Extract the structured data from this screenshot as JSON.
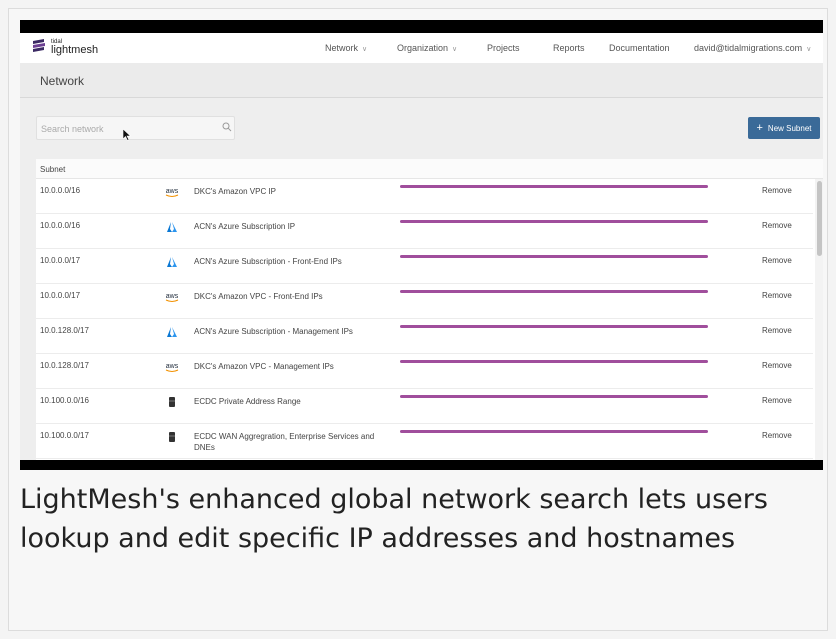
{
  "app": {
    "logo_small": "tidal",
    "logo_big": "lightmesh"
  },
  "nav": {
    "items": [
      {
        "label": "Network",
        "dropdown": true
      },
      {
        "label": "Organization",
        "dropdown": true
      },
      {
        "label": "Projects",
        "dropdown": false
      },
      {
        "label": "Reports",
        "dropdown": false
      },
      {
        "label": "Documentation",
        "dropdown": false
      },
      {
        "label": "david@tidalmigrations.com",
        "dropdown": true
      }
    ]
  },
  "page": {
    "title": "Network"
  },
  "search": {
    "placeholder": "Search network",
    "value": ""
  },
  "actions": {
    "new_subnet_label": "New Subnet"
  },
  "table": {
    "header_subnet": "Subnet",
    "remove_label": "Remove",
    "rows": [
      {
        "subnet": "10.0.0.0/16",
        "provider": "aws",
        "name": "DKC's Amazon VPC IP"
      },
      {
        "subnet": "10.0.0.0/16",
        "provider": "azure",
        "name": "ACN's Azure Subscription IP"
      },
      {
        "subnet": "10.0.0.0/17",
        "provider": "azure",
        "name": "ACN's Azure Subscription - Front-End IPs"
      },
      {
        "subnet": "10.0.0.0/17",
        "provider": "aws",
        "name": "DKC's Amazon VPC - Front-End IPs"
      },
      {
        "subnet": "10.0.128.0/17",
        "provider": "azure",
        "name": "ACN's Azure Subscription - Management IPs"
      },
      {
        "subnet": "10.0.128.0/17",
        "provider": "aws",
        "name": "DKC's Amazon VPC - Management IPs"
      },
      {
        "subnet": "10.100.0.0/16",
        "provider": "datacenter",
        "name": "ECDC Private Address Range"
      },
      {
        "subnet": "10.100.0.0/17",
        "provider": "datacenter",
        "name": "ECDC WAN Aggregration, Enterprise Services and DNEs"
      }
    ]
  },
  "colors": {
    "accent_button": "#3a6a98",
    "usage_bar": "#a04e9c",
    "azure_blue": "#0a78d4",
    "aws_orange": "#f29100"
  },
  "icons": {
    "aws": "aws-icon",
    "azure": "azure-icon",
    "datacenter": "server-icon",
    "search": "search-icon"
  },
  "caption": "LightMesh's enhanced global network search lets users lookup and edit specific IP addresses and hostnames"
}
